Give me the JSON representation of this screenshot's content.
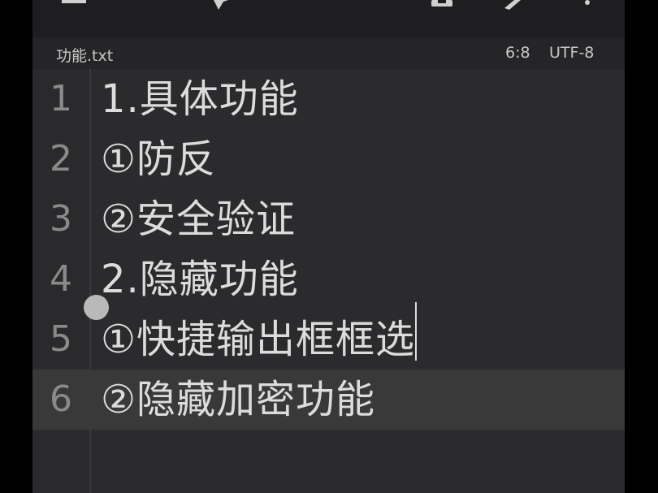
{
  "status_bar": {
    "file_name": "功能.txt",
    "cursor_position": "6:8",
    "encoding": "UTF-8"
  },
  "toolbar": {
    "icons": [
      "menu-icon",
      "bookmark-icon",
      "save-icon",
      "edit-icon",
      "more-icon"
    ]
  },
  "editor": {
    "current_line": 6,
    "lines": [
      {
        "number": "1",
        "text": "1.具体功能"
      },
      {
        "number": "2",
        "text": "①防反"
      },
      {
        "number": "3",
        "text": "②安全验证"
      },
      {
        "number": "4",
        "text": "2.隐藏功能"
      },
      {
        "number": "5",
        "text": "①快捷输出框框选"
      },
      {
        "number": "6",
        "text": "②隐藏加密功能"
      }
    ]
  }
}
